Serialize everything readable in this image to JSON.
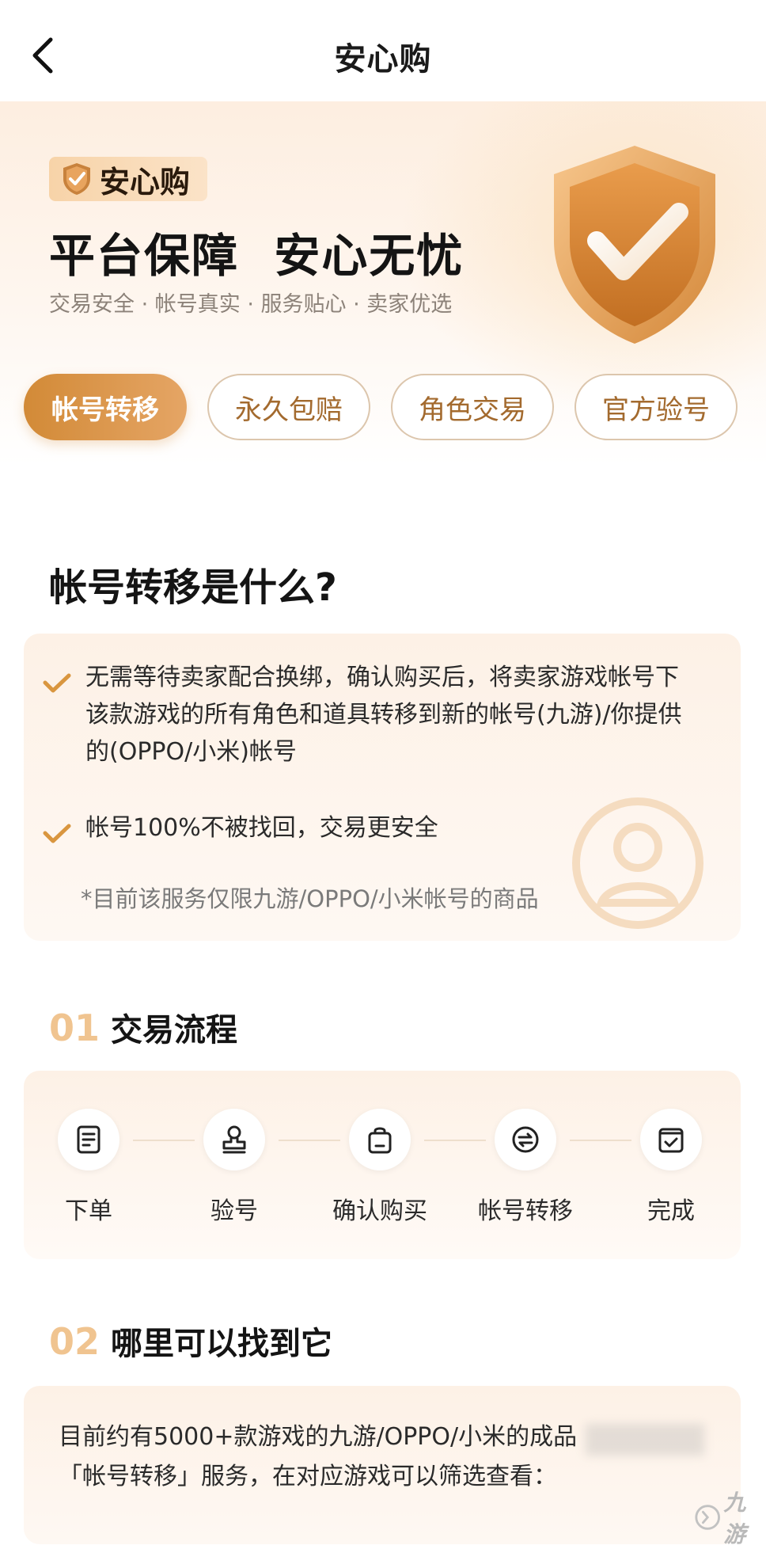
{
  "navbar": {
    "title": "安心购"
  },
  "hero": {
    "badge": "安心购",
    "title": "平台保障  安心无忧",
    "subtitle": "交易安全 · 帐号真实 · 服务贴心 · 卖家优选"
  },
  "tabs": [
    {
      "label": "帐号转移",
      "active": true
    },
    {
      "label": "永久包赔",
      "active": false
    },
    {
      "label": "角色交易",
      "active": false
    },
    {
      "label": "官方验号",
      "active": false
    }
  ],
  "what_is": {
    "title": "帐号转移是什么?",
    "bullets": [
      "无需等待卖家配合换绑，确认购买后，将卖家游戏帐号下该款游戏的所有角色和道具转移到新的帐号(九游)/你提供的(OPPO/小米)帐号",
      "帐号100%不被找回，交易更安全"
    ],
    "note": "*目前该服务仅限九游/OPPO/小米帐号的商品"
  },
  "flow": {
    "number": "01",
    "title": "交易流程",
    "steps": [
      {
        "label": "下单",
        "icon": "order-icon"
      },
      {
        "label": "验号",
        "icon": "stamp-icon"
      },
      {
        "label": "确认购买",
        "icon": "shopping-bag-icon"
      },
      {
        "label": "帐号转移",
        "icon": "transfer-icon"
      },
      {
        "label": "完成",
        "icon": "calendar-check-icon"
      }
    ]
  },
  "where": {
    "number": "02",
    "title": "哪里可以找到它",
    "text_line1": "目前约有5000+款游戏的九游/OPPO/小米的成品",
    "text_line2": "「帐号转移」服务，在对应游戏可以筛选查看："
  },
  "watermark": {
    "text": "九游"
  },
  "colors": {
    "accent": "#d28a37",
    "accent_light": "#f0c490",
    "card_bg": "#fdf1e6"
  }
}
